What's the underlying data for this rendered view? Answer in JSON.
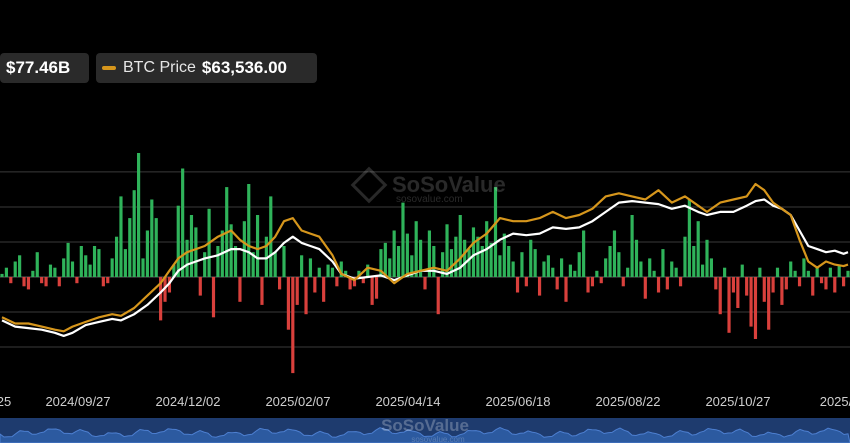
{
  "legend": {
    "flow_value": "$77.46B",
    "btc_label": "BTC Price",
    "btc_value": "$63,536.00"
  },
  "watermark": {
    "brand": "SoSoValue",
    "url": "sosovalue.com"
  },
  "colors": {
    "background": "#000000",
    "inflow": "#2fb35a",
    "outflow": "#d9403c",
    "btc_price": "#d6961c",
    "net_assets": "#ffffff",
    "grid": "#3a3a3a",
    "navigator": "#1e3b6e"
  },
  "chart_data": {
    "type": "bar+line",
    "x_tick_labels": [
      "25",
      "2024/09/27",
      "2024/12/02",
      "2025/02/07",
      "2025/04/14",
      "2025/06/18",
      "2025/08/22",
      "2025/10/27",
      "2025/"
    ],
    "bar_series": {
      "name": "",
      "points": [
        [
          0,
          0.1
        ],
        [
          1,
          0.3
        ],
        [
          2,
          -0.2
        ],
        [
          3,
          0.5
        ],
        [
          4,
          0.7
        ],
        [
          5,
          -0.3
        ],
        [
          6,
          -0.4
        ],
        [
          7,
          0.2
        ],
        [
          8,
          0.8
        ],
        [
          9,
          -0.2
        ],
        [
          10,
          -0.3
        ],
        [
          11,
          0.4
        ],
        [
          12,
          0.3
        ],
        [
          13,
          -0.3
        ],
        [
          14,
          0.6
        ],
        [
          15,
          1.1
        ],
        [
          16,
          0.5
        ],
        [
          17,
          -0.2
        ],
        [
          18,
          1.0
        ],
        [
          19,
          0.7
        ],
        [
          20,
          0.4
        ],
        [
          21,
          1.0
        ],
        [
          22,
          0.9
        ],
        [
          23,
          -0.3
        ],
        [
          24,
          -0.2
        ],
        [
          25,
          0.6
        ],
        [
          26,
          1.3
        ],
        [
          27,
          2.6
        ],
        [
          28,
          0.9
        ],
        [
          29,
          1.9
        ],
        [
          30,
          2.8
        ],
        [
          31,
          4.0
        ],
        [
          32,
          0.6
        ],
        [
          33,
          1.5
        ],
        [
          34,
          2.5
        ],
        [
          35,
          1.9
        ],
        [
          36,
          -1.4
        ],
        [
          37,
          -0.8
        ],
        [
          38,
          -0.5
        ],
        [
          39,
          0.4
        ],
        [
          40,
          2.3
        ],
        [
          41,
          3.5
        ],
        [
          42,
          1.2
        ],
        [
          43,
          2.0
        ],
        [
          44,
          1.6
        ],
        [
          45,
          -0.6
        ],
        [
          46,
          0.8
        ],
        [
          47,
          2.2
        ],
        [
          48,
          -1.3
        ],
        [
          49,
          1.0
        ],
        [
          50,
          1.5
        ],
        [
          51,
          2.9
        ],
        [
          52,
          1.7
        ],
        [
          53,
          1.0
        ],
        [
          54,
          -0.8
        ],
        [
          55,
          1.8
        ],
        [
          56,
          3.0
        ],
        [
          57,
          0.8
        ],
        [
          58,
          2.0
        ],
        [
          59,
          -0.9
        ],
        [
          60,
          1.3
        ],
        [
          61,
          2.6
        ],
        [
          62,
          0.8
        ],
        [
          63,
          -0.4
        ],
        [
          64,
          1.0
        ],
        [
          65,
          -1.7
        ],
        [
          66,
          -3.1
        ],
        [
          67,
          -0.9
        ],
        [
          68,
          0.7
        ],
        [
          69,
          -1.2
        ],
        [
          70,
          0.6
        ],
        [
          71,
          -0.5
        ],
        [
          72,
          0.3
        ],
        [
          73,
          -0.8
        ],
        [
          74,
          0.4
        ],
        [
          75,
          0.3
        ],
        [
          76,
          -0.3
        ],
        [
          77,
          0.5
        ],
        [
          78,
          0.2
        ],
        [
          79,
          -0.4
        ],
        [
          80,
          -0.3
        ],
        [
          81,
          0.2
        ],
        [
          82,
          -0.2
        ],
        [
          83,
          0.4
        ],
        [
          84,
          -0.9
        ],
        [
          85,
          -0.7
        ],
        [
          86,
          0.9
        ],
        [
          87,
          1.1
        ],
        [
          88,
          0.6
        ],
        [
          89,
          1.5
        ],
        [
          90,
          1.0
        ],
        [
          91,
          2.4
        ],
        [
          92,
          1.4
        ],
        [
          93,
          0.7
        ],
        [
          94,
          1.8
        ],
        [
          95,
          1.2
        ],
        [
          96,
          -0.4
        ],
        [
          97,
          1.5
        ],
        [
          98,
          1.0
        ],
        [
          99,
          -1.2
        ],
        [
          100,
          0.8
        ],
        [
          101,
          1.7
        ],
        [
          102,
          0.9
        ],
        [
          103,
          1.3
        ],
        [
          104,
          2.0
        ],
        [
          105,
          1.2
        ],
        [
          106,
          0.9
        ],
        [
          107,
          1.6
        ],
        [
          108,
          1.3
        ],
        [
          109,
          1.0
        ],
        [
          110,
          1.8
        ],
        [
          111,
          1.1
        ],
        [
          112,
          2.9
        ],
        [
          113,
          0.7
        ],
        [
          114,
          1.4
        ],
        [
          115,
          1.0
        ],
        [
          116,
          0.5
        ],
        [
          117,
          -0.5
        ],
        [
          118,
          0.8
        ],
        [
          119,
          -0.3
        ],
        [
          120,
          1.2
        ],
        [
          121,
          0.9
        ],
        [
          122,
          -0.6
        ],
        [
          123,
          0.5
        ],
        [
          124,
          0.7
        ],
        [
          125,
          0.3
        ],
        [
          126,
          -0.4
        ],
        [
          127,
          0.6
        ],
        [
          128,
          -0.8
        ],
        [
          129,
          0.4
        ],
        [
          130,
          0.2
        ],
        [
          131,
          0.8
        ],
        [
          132,
          1.5
        ],
        [
          133,
          -0.5
        ],
        [
          134,
          -0.3
        ],
        [
          135,
          0.2
        ],
        [
          136,
          -0.2
        ],
        [
          137,
          0.6
        ],
        [
          138,
          1.0
        ],
        [
          139,
          1.5
        ],
        [
          140,
          0.8
        ],
        [
          141,
          -0.3
        ],
        [
          142,
          0.3
        ],
        [
          143,
          2.0
        ],
        [
          144,
          1.2
        ],
        [
          145,
          0.5
        ],
        [
          146,
          -0.7
        ],
        [
          147,
          0.6
        ],
        [
          148,
          0.2
        ],
        [
          149,
          -0.5
        ],
        [
          150,
          0.9
        ],
        [
          151,
          -0.4
        ],
        [
          152,
          0.5
        ],
        [
          153,
          0.3
        ],
        [
          154,
          -0.3
        ],
        [
          155,
          1.3
        ],
        [
          156,
          2.5
        ],
        [
          157,
          1.0
        ],
        [
          158,
          1.8
        ],
        [
          159,
          0.4
        ],
        [
          160,
          1.2
        ],
        [
          161,
          0.6
        ],
        [
          162,
          -0.4
        ],
        [
          163,
          -1.2
        ],
        [
          164,
          0.3
        ],
        [
          165,
          -1.8
        ],
        [
          166,
          -0.5
        ],
        [
          167,
          -1.0
        ],
        [
          168,
          0.4
        ],
        [
          169,
          -0.6
        ],
        [
          170,
          -1.6
        ],
        [
          171,
          -2.0
        ],
        [
          172,
          0.3
        ],
        [
          173,
          -0.8
        ],
        [
          174,
          -1.7
        ],
        [
          175,
          -0.5
        ],
        [
          176,
          0.3
        ],
        [
          177,
          -0.9
        ],
        [
          178,
          -0.4
        ],
        [
          179,
          0.5
        ],
        [
          180,
          0.2
        ],
        [
          181,
          -0.3
        ],
        [
          182,
          0.6
        ],
        [
          183,
          0.2
        ],
        [
          184,
          -0.6
        ],
        [
          185,
          0.3
        ],
        [
          186,
          -0.2
        ],
        [
          187,
          -0.4
        ],
        [
          188,
          0.3
        ],
        [
          189,
          -0.5
        ],
        [
          190,
          0.4
        ],
        [
          191,
          -0.3
        ],
        [
          192,
          0.2
        ]
      ]
    },
    "line_series": [
      {
        "name": "",
        "color": "#ffffff",
        "points": [
          [
            0,
            -1.4
          ],
          [
            3,
            -1.6
          ],
          [
            6,
            -1.65
          ],
          [
            9,
            -1.7
          ],
          [
            12,
            -1.8
          ],
          [
            14,
            -1.9
          ],
          [
            16,
            -1.8
          ],
          [
            19,
            -1.55
          ],
          [
            22,
            -1.45
          ],
          [
            25,
            -1.35
          ],
          [
            27,
            -1.4
          ],
          [
            30,
            -1.2
          ],
          [
            33,
            -0.9
          ],
          [
            36,
            -0.5
          ],
          [
            38,
            -0.2
          ],
          [
            40,
            0.2
          ],
          [
            42,
            0.4
          ],
          [
            44,
            0.5
          ],
          [
            46,
            0.6
          ],
          [
            49,
            0.7
          ],
          [
            52,
            0.9
          ],
          [
            54,
            0.9
          ],
          [
            56,
            0.8
          ],
          [
            58,
            0.6
          ],
          [
            60,
            0.6
          ],
          [
            62,
            0.8
          ],
          [
            64,
            1.1
          ],
          [
            66,
            1.3
          ],
          [
            68,
            1.1
          ],
          [
            70,
            1.0
          ],
          [
            72,
            0.9
          ],
          [
            75,
            0.5
          ],
          [
            77,
            0.1
          ],
          [
            80,
            -0.05
          ],
          [
            83,
            0.0
          ],
          [
            86,
            0.05
          ],
          [
            89,
            -0.1
          ],
          [
            92,
            0.05
          ],
          [
            95,
            0.2
          ],
          [
            98,
            0.2
          ],
          [
            101,
            0.1
          ],
          [
            104,
            0.3
          ],
          [
            107,
            0.7
          ],
          [
            110,
            0.9
          ],
          [
            113,
            1.2
          ],
          [
            116,
            1.4
          ],
          [
            119,
            1.35
          ],
          [
            122,
            1.4
          ],
          [
            125,
            1.6
          ],
          [
            128,
            1.55
          ],
          [
            131,
            1.6
          ],
          [
            134,
            1.8
          ],
          [
            137,
            2.1
          ],
          [
            140,
            2.4
          ],
          [
            143,
            2.45
          ],
          [
            146,
            2.4
          ],
          [
            149,
            2.35
          ],
          [
            152,
            2.2
          ],
          [
            155,
            2.3
          ],
          [
            158,
            2.1
          ],
          [
            160,
            2.0
          ],
          [
            163,
            2.1
          ],
          [
            166,
            2.1
          ],
          [
            169,
            2.3
          ],
          [
            171,
            2.45
          ],
          [
            173,
            2.5
          ],
          [
            175,
            2.3
          ],
          [
            177,
            2.2
          ],
          [
            179,
            2.0
          ],
          [
            181,
            1.5
          ],
          [
            183,
            1.0
          ],
          [
            185,
            0.9
          ],
          [
            187,
            0.8
          ],
          [
            189,
            0.85
          ],
          [
            191,
            0.75
          ],
          [
            192,
            0.8
          ]
        ]
      },
      {
        "name": "BTC Price",
        "color": "#d6961c",
        "points": [
          [
            0,
            -1.3
          ],
          [
            3,
            -1.5
          ],
          [
            6,
            -1.5
          ],
          [
            9,
            -1.6
          ],
          [
            12,
            -1.7
          ],
          [
            14,
            -1.75
          ],
          [
            16,
            -1.6
          ],
          [
            19,
            -1.45
          ],
          [
            22,
            -1.3
          ],
          [
            25,
            -1.2
          ],
          [
            27,
            -1.25
          ],
          [
            30,
            -1.0
          ],
          [
            33,
            -0.6
          ],
          [
            36,
            -0.2
          ],
          [
            38,
            0.2
          ],
          [
            40,
            0.6
          ],
          [
            42,
            0.8
          ],
          [
            44,
            0.9
          ],
          [
            46,
            1.0
          ],
          [
            49,
            1.3
          ],
          [
            52,
            1.5
          ],
          [
            54,
            1.2
          ],
          [
            56,
            1.0
          ],
          [
            58,
            0.9
          ],
          [
            60,
            1.0
          ],
          [
            62,
            1.3
          ],
          [
            64,
            1.8
          ],
          [
            66,
            1.9
          ],
          [
            68,
            1.5
          ],
          [
            70,
            1.4
          ],
          [
            72,
            1.3
          ],
          [
            75,
            0.7
          ],
          [
            77,
            0.1
          ],
          [
            80,
            -0.1
          ],
          [
            83,
            0.3
          ],
          [
            86,
            0.2
          ],
          [
            89,
            -0.2
          ],
          [
            92,
            0.1
          ],
          [
            95,
            0.2
          ],
          [
            98,
            0.3
          ],
          [
            101,
            0.2
          ],
          [
            104,
            0.6
          ],
          [
            107,
            1.1
          ],
          [
            110,
            1.4
          ],
          [
            113,
            1.9
          ],
          [
            116,
            1.8
          ],
          [
            119,
            1.8
          ],
          [
            122,
            1.9
          ],
          [
            125,
            2.1
          ],
          [
            128,
            1.9
          ],
          [
            131,
            2.0
          ],
          [
            134,
            2.2
          ],
          [
            137,
            2.6
          ],
          [
            140,
            2.7
          ],
          [
            143,
            2.6
          ],
          [
            146,
            2.5
          ],
          [
            149,
            2.8
          ],
          [
            152,
            2.4
          ],
          [
            155,
            2.6
          ],
          [
            158,
            2.3
          ],
          [
            160,
            2.1
          ],
          [
            163,
            2.4
          ],
          [
            166,
            2.5
          ],
          [
            169,
            2.6
          ],
          [
            171,
            3.0
          ],
          [
            173,
            2.8
          ],
          [
            175,
            2.4
          ],
          [
            177,
            2.2
          ],
          [
            179,
            2.0
          ],
          [
            181,
            1.2
          ],
          [
            183,
            0.5
          ],
          [
            185,
            0.3
          ],
          [
            187,
            0.5
          ],
          [
            189,
            0.4
          ],
          [
            191,
            0.35
          ],
          [
            192,
            0.4
          ]
        ]
      }
    ],
    "y_range": [
      -3.2,
      3.6
    ],
    "x_range": [
      0,
      192
    ],
    "grid": true,
    "legend_position": "top-left"
  }
}
